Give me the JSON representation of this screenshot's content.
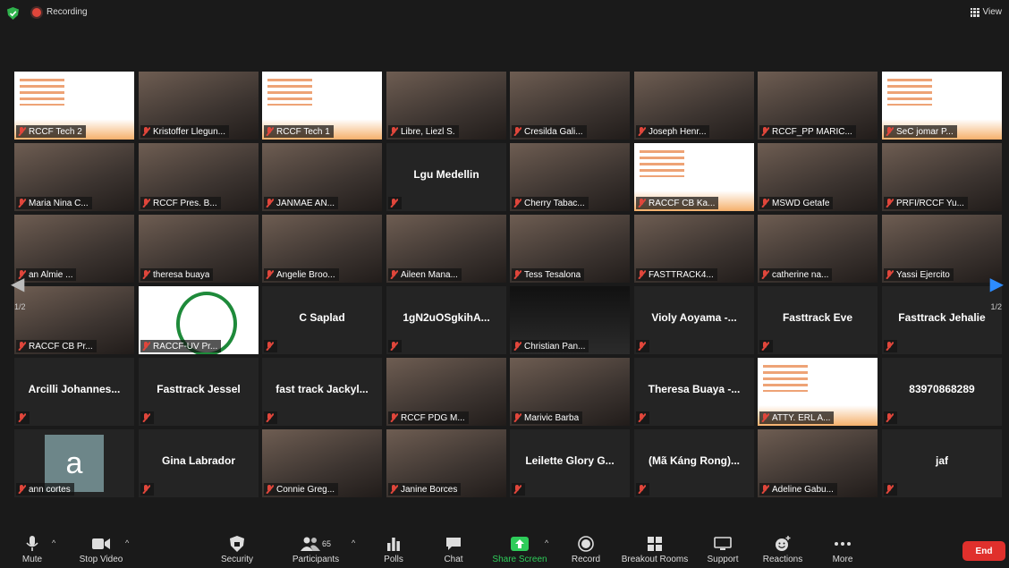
{
  "topbar": {
    "recording_label": "Recording",
    "view_label": "View"
  },
  "gallery": {
    "page_indicator": "1/2",
    "rows": [
      [
        {
          "name": "RCCF Tech 2",
          "kind": "poster"
        },
        {
          "name": "Kristoffer Llegun...",
          "kind": "photo"
        },
        {
          "name": "RCCF Tech 1",
          "kind": "poster"
        },
        {
          "name": "Libre, Liezl S.",
          "kind": "photo"
        },
        {
          "name": "Cresilda Gali...",
          "kind": "photo"
        },
        {
          "name": "Joseph Henr...",
          "kind": "photo"
        },
        {
          "name": "RCCF_PP MARIC...",
          "kind": "photo",
          "active": true
        },
        {
          "name": "SeC jomar P...",
          "kind": "poster"
        }
      ],
      [
        {
          "name": "Maria Nina C...",
          "kind": "photo"
        },
        {
          "name": "RCCF Pres. B...",
          "kind": "photo"
        },
        {
          "name": "JANMAE AN...",
          "kind": "photo"
        },
        {
          "name": "",
          "kind": "name",
          "center": "Lgu Medellin"
        },
        {
          "name": "Cherry Tabac...",
          "kind": "photo"
        },
        {
          "name": "RACCF CB Ka...",
          "kind": "poster"
        },
        {
          "name": "MSWD Getafe",
          "kind": "photo"
        },
        {
          "name": "PRFI/RCCF Yu...",
          "kind": "photo"
        }
      ],
      [
        {
          "name": "an Almie ...",
          "kind": "photo"
        },
        {
          "name": "theresa buaya",
          "kind": "photo"
        },
        {
          "name": "Angelie Broo...",
          "kind": "photo"
        },
        {
          "name": "Aileen Mana...",
          "kind": "photo"
        },
        {
          "name": "Tess Tesalona",
          "kind": "photo"
        },
        {
          "name": "FASTTRACK4...",
          "kind": "photo"
        },
        {
          "name": "catherine na...",
          "kind": "photo"
        },
        {
          "name": "Yassi Ejercito",
          "kind": "photo"
        }
      ],
      [
        {
          "name": "RACCF CB Pr...",
          "kind": "photo"
        },
        {
          "name": "RACCF-UV Pr...",
          "kind": "green"
        },
        {
          "name": "",
          "kind": "name",
          "center": "C Saplad"
        },
        {
          "name": "",
          "kind": "name",
          "center": "1gN2uOSgkihA..."
        },
        {
          "name": "Christian Pan...",
          "kind": "dark"
        },
        {
          "name": "",
          "kind": "name",
          "center": "Violy Aoyama -..."
        },
        {
          "name": "",
          "kind": "name",
          "center": "Fasttrack Eve"
        },
        {
          "name": "",
          "kind": "name",
          "center": "Fasttrack Jehalie"
        }
      ],
      [
        {
          "name": "",
          "kind": "name",
          "center": "Arcilli Johannes..."
        },
        {
          "name": "",
          "kind": "name",
          "center": "Fasttrack Jessel"
        },
        {
          "name": "",
          "kind": "name",
          "center": "fast track Jackyl..."
        },
        {
          "name": "RCCF PDG M...",
          "kind": "photo"
        },
        {
          "name": "Marivic Barba",
          "kind": "photo"
        },
        {
          "name": "",
          "kind": "name",
          "center": "Theresa Buaya -..."
        },
        {
          "name": "ATTY. ERL A...",
          "kind": "poster"
        },
        {
          "name": "",
          "kind": "name",
          "center": "83970868289"
        }
      ],
      [
        {
          "name": "ann cortes",
          "kind": "letter",
          "letter": "a"
        },
        {
          "name": "",
          "kind": "name",
          "center": "Gina Labrador"
        },
        {
          "name": "Connie Greg...",
          "kind": "photo"
        },
        {
          "name": "Janine Borces",
          "kind": "photo"
        },
        {
          "name": "",
          "kind": "name",
          "center": "Leilette Glory G..."
        },
        {
          "name": "",
          "kind": "name",
          "center": "(Mã Káng Rong)..."
        },
        {
          "name": "Adeline Gabu...",
          "kind": "photo"
        },
        {
          "name": "",
          "kind": "name",
          "center": "jaf"
        }
      ]
    ]
  },
  "toolbar": {
    "mute": "Mute",
    "stop_video": "Stop Video",
    "security": "Security",
    "participants": "Participants",
    "participants_count": "65",
    "polls": "Polls",
    "chat": "Chat",
    "share_screen": "Share Screen",
    "record": "Record",
    "breakout_rooms": "Breakout Rooms",
    "support": "Support",
    "reactions": "Reactions",
    "more": "More",
    "end": "End"
  },
  "colors": {
    "accent_blue": "#2d8cff",
    "share_green": "#2ecc5a",
    "end_red": "#e0302c",
    "mic_off_red": "#e0463b",
    "active_speaker": "#e8e28a"
  }
}
